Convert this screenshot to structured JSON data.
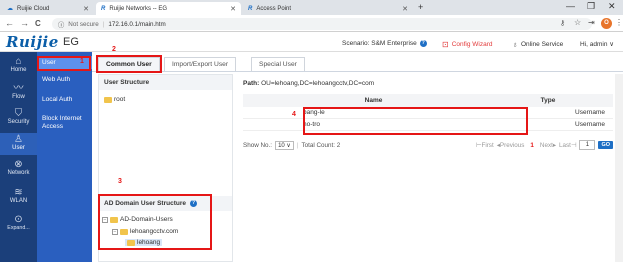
{
  "browser": {
    "tabs": [
      {
        "label": "Ruijie Cloud"
      },
      {
        "label": "Ruijie Networks -- EG"
      },
      {
        "label": "Access Point"
      }
    ],
    "new_tab": "+",
    "win_controls": [
      "—",
      "❐",
      "✕"
    ],
    "nav": {
      "back": "←",
      "forward": "→",
      "reload": "C"
    },
    "security": "Not secure",
    "url": "172.16.0.1/main.htm",
    "profile_initial": "O"
  },
  "header": {
    "logo": "Ruijie",
    "product": "EG",
    "scenario": "Scenario: S&M Enterprise",
    "config_wizard": "Config Wizard",
    "online_service": "Online Service",
    "user": "Hi, admin ∨"
  },
  "sidebar": {
    "items": [
      {
        "label": "Home",
        "icon": "home-icon",
        "glyph": "⌂"
      },
      {
        "label": "Flow",
        "icon": "flow-icon",
        "glyph": "〰"
      },
      {
        "label": "Security",
        "icon": "shield-icon",
        "glyph": "⛉"
      },
      {
        "label": "User",
        "icon": "user-icon",
        "glyph": "♙"
      },
      {
        "label": "Network",
        "icon": "network-icon",
        "glyph": "⊗"
      },
      {
        "label": "WLAN",
        "icon": "wifi-icon",
        "glyph": "≋"
      },
      {
        "label": "Expand...",
        "icon": "expand-icon",
        "glyph": "⊙"
      }
    ]
  },
  "submenu": {
    "items": [
      {
        "label": "User"
      },
      {
        "label": "Web Auth"
      },
      {
        "label": "Local Auth"
      },
      {
        "label": "Block Internet Access"
      }
    ]
  },
  "main_tabs": [
    {
      "label": "Common User"
    },
    {
      "label": "Import/Export User"
    },
    {
      "label": "Special User"
    }
  ],
  "user_structure": {
    "title": "User Structure",
    "root": "root"
  },
  "ad_structure": {
    "title": "AD Domain User Structure",
    "nodes": [
      "AD-Domain-Users",
      "lehoangcctv.com",
      "lehoang"
    ]
  },
  "path": {
    "label": "Path:",
    "value": "OU=lehoang,DC=lehoangcctv,DC=com"
  },
  "table": {
    "headers": {
      "name": "Name",
      "type": "Type"
    },
    "rows": [
      {
        "name": "bang-le",
        "type": "Username"
      },
      {
        "name": "ho-tro",
        "type": "Username"
      }
    ]
  },
  "pager": {
    "show_label": "Show No.:",
    "show_value": "10",
    "total": "Total Count: 2",
    "first": "First",
    "previous": "Previous",
    "current": "1",
    "next": "Next",
    "last": "Last",
    "page_input": "1",
    "go": "GO"
  },
  "annotations": [
    "1",
    "2",
    "3",
    "4"
  ],
  "colors": {
    "sidebar": "#1b3f7a",
    "submenu": "#2a5fbf",
    "highlight": "#e51616",
    "accent": "#1e6fc5"
  }
}
